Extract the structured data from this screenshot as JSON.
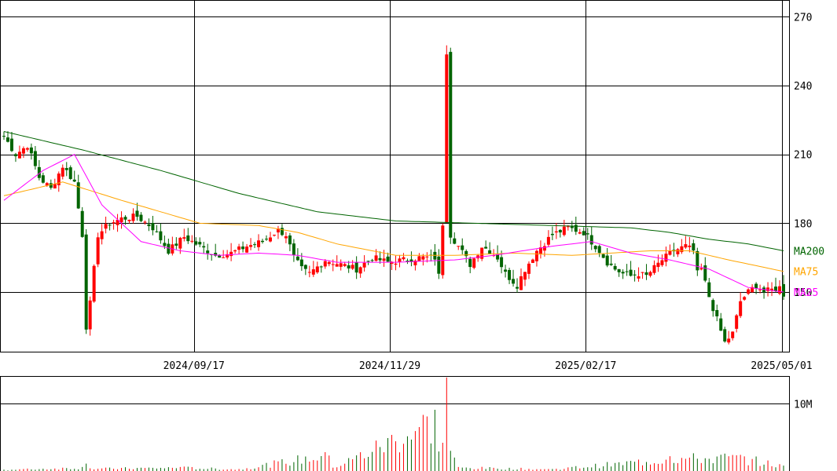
{
  "chart_data": {
    "type": "candlestick",
    "price_axis": {
      "ylim": [
        124,
        277
      ],
      "ticks": [
        {
          "value": 150,
          "label": "150"
        },
        {
          "value": 180,
          "label": "180"
        },
        {
          "value": 210,
          "label": "210"
        },
        {
          "value": 240,
          "label": "240"
        },
        {
          "value": 270,
          "label": "270"
        }
      ]
    },
    "volume_axis": {
      "ylim": [
        0,
        14
      ],
      "ticks": [
        {
          "value": 10,
          "label": "10M"
        }
      ],
      "unit": "M"
    },
    "date_ticks": [
      {
        "index": 49,
        "label": "2024/09/17"
      },
      {
        "index": 99,
        "label": "2024/11/29"
      },
      {
        "index": 149,
        "label": "2025/02/17"
      },
      {
        "index": 199,
        "label": "2025/05/01"
      }
    ],
    "bar_count": 200,
    "legend": [
      {
        "name": "MA200",
        "color": "#006400"
      },
      {
        "name": "MA75",
        "color": "#ffa500"
      },
      {
        "name": "MA25",
        "color": "#ff00ff"
      }
    ],
    "colors": {
      "up": "#ff0000",
      "down": "#006400",
      "grid": "#000000"
    },
    "grid": true,
    "legend_placement": "right",
    "anchors": {
      "close": [
        [
          0,
          218
        ],
        [
          3,
          210
        ],
        [
          6,
          214
        ],
        [
          9,
          200
        ],
        [
          12,
          195
        ],
        [
          15,
          205
        ],
        [
          18,
          198
        ],
        [
          20,
          175
        ],
        [
          21,
          135
        ],
        [
          22,
          145
        ],
        [
          24,
          175
        ],
        [
          27,
          180
        ],
        [
          30,
          182
        ],
        [
          34,
          183
        ],
        [
          38,
          178
        ],
        [
          42,
          168
        ],
        [
          46,
          174
        ],
        [
          50,
          170
        ],
        [
          54,
          166
        ],
        [
          58,
          167
        ],
        [
          62,
          170
        ],
        [
          66,
          172
        ],
        [
          70,
          177
        ],
        [
          72,
          175
        ],
        [
          74,
          165
        ],
        [
          76,
          160
        ],
        [
          78,
          158
        ],
        [
          82,
          164
        ],
        [
          86,
          162
        ],
        [
          90,
          160
        ],
        [
          94,
          165
        ],
        [
          98,
          163
        ],
        [
          102,
          164
        ],
        [
          106,
          165
        ],
        [
          110,
          165
        ],
        [
          111,
          157
        ],
        [
          112,
          180
        ],
        [
          113,
          255
        ],
        [
          114,
          175
        ],
        [
          116,
          170
        ],
        [
          119,
          162
        ],
        [
          122,
          170
        ],
        [
          124,
          168
        ],
        [
          126,
          165
        ],
        [
          128,
          158
        ],
        [
          131,
          153
        ],
        [
          133,
          160
        ],
        [
          136,
          168
        ],
        [
          140,
          175
        ],
        [
          144,
          178
        ],
        [
          148,
          176
        ],
        [
          150,
          172
        ],
        [
          152,
          168
        ],
        [
          154,
          163
        ],
        [
          156,
          160
        ],
        [
          158,
          158
        ],
        [
          160,
          157
        ],
        [
          162,
          158
        ],
        [
          164,
          157
        ],
        [
          168,
          164
        ],
        [
          171,
          168
        ],
        [
          174,
          170
        ],
        [
          176,
          168
        ],
        [
          177,
          158
        ],
        [
          178,
          160
        ],
        [
          180,
          148
        ],
        [
          182,
          138
        ],
        [
          184,
          128
        ],
        [
          186,
          132
        ],
        [
          188,
          146
        ],
        [
          190,
          150
        ],
        [
          192,
          153
        ],
        [
          194,
          150
        ],
        [
          196,
          151
        ],
        [
          198,
          152
        ],
        [
          199,
          149
        ]
      ],
      "volume_m": [
        [
          0,
          0.2
        ],
        [
          20,
          0.6
        ],
        [
          21,
          1.1
        ],
        [
          22,
          0.4
        ],
        [
          45,
          0.6
        ],
        [
          60,
          0.3
        ],
        [
          82,
          2.8
        ],
        [
          83,
          2.3
        ],
        [
          84,
          0.5
        ],
        [
          110,
          9.1
        ],
        [
          111,
          2.9
        ],
        [
          112,
          4.2
        ],
        [
          113,
          13.9
        ],
        [
          114,
          3.0
        ],
        [
          115,
          2.0
        ],
        [
          116,
          0.6
        ],
        [
          140,
          0.3
        ],
        [
          157,
          1.3
        ],
        [
          170,
          2.2
        ],
        [
          188,
          2.4
        ],
        [
          199,
          0.8
        ]
      ],
      "ma25": [
        [
          0,
          190
        ],
        [
          10,
          203
        ],
        [
          18,
          210
        ],
        [
          25,
          188
        ],
        [
          35,
          172
        ],
        [
          45,
          168
        ],
        [
          55,
          166
        ],
        [
          65,
          167
        ],
        [
          75,
          166
        ],
        [
          85,
          163
        ],
        [
          100,
          163
        ],
        [
          115,
          164
        ],
        [
          125,
          166
        ],
        [
          140,
          170
        ],
        [
          150,
          172
        ],
        [
          160,
          167
        ],
        [
          170,
          164
        ],
        [
          180,
          160
        ],
        [
          190,
          152
        ],
        [
          199,
          150
        ]
      ],
      "ma75": [
        [
          0,
          192
        ],
        [
          15,
          198
        ],
        [
          30,
          190
        ],
        [
          50,
          180
        ],
        [
          65,
          179
        ],
        [
          75,
          176
        ],
        [
          85,
          171
        ],
        [
          100,
          166
        ],
        [
          115,
          166
        ],
        [
          130,
          167
        ],
        [
          145,
          166
        ],
        [
          155,
          167
        ],
        [
          165,
          168
        ],
        [
          175,
          168
        ],
        [
          185,
          164
        ],
        [
          199,
          159
        ]
      ],
      "ma200": [
        [
          0,
          220
        ],
        [
          20,
          212
        ],
        [
          40,
          203
        ],
        [
          60,
          193
        ],
        [
          80,
          185
        ],
        [
          100,
          181
        ],
        [
          120,
          180
        ],
        [
          140,
          179
        ],
        [
          160,
          178
        ],
        [
          170,
          176
        ],
        [
          180,
          173
        ],
        [
          190,
          171
        ],
        [
          199,
          168
        ]
      ]
    }
  }
}
